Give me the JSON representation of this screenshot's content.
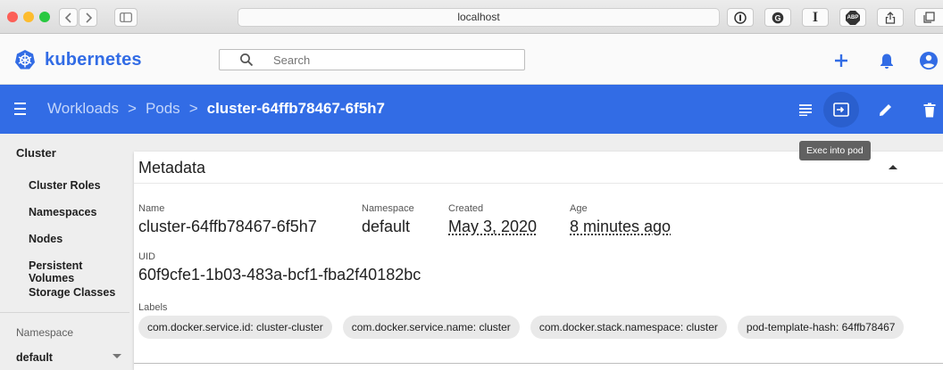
{
  "browser": {
    "url": "localhost",
    "extensions": [
      "onepassword-icon",
      "ghostery-icon",
      "instapaper-icon",
      "adblock-icon"
    ],
    "adblock_label": "ABP",
    "instapaper_label": "I"
  },
  "header": {
    "logo_text": "kubernetes",
    "search_placeholder": "Search",
    "accent_color": "#326ce5"
  },
  "toolbar": {
    "breadcrumb": {
      "workloads": "Workloads",
      "pods": "Pods",
      "separator": ">",
      "current": "cluster-64ffb78467-6f5h7"
    },
    "color": "#326ce5"
  },
  "tooltip": {
    "text": "Exec into pod"
  },
  "sidebar": {
    "section_title": "Cluster",
    "items": [
      {
        "label": "Cluster Roles"
      },
      {
        "label": "Namespaces"
      },
      {
        "label": "Nodes"
      },
      {
        "label": "Persistent Volumes"
      },
      {
        "label": "Storage Classes"
      }
    ],
    "namespace_label": "Namespace",
    "namespace_value": "default"
  },
  "metadata": {
    "title": "Metadata",
    "name_label": "Name",
    "name_value": "cluster-64ffb78467-6f5h7",
    "namespace_label": "Namespace",
    "namespace_value": "default",
    "created_label": "Created",
    "created_value": "May 3, 2020",
    "age_label": "Age",
    "age_value": "8 minutes ago",
    "uid_label": "UID",
    "uid_value": "60f9cfe1-1b03-483a-bcf1-fba2f40182bc",
    "labels_label": "Labels",
    "labels": [
      "com.docker.service.id: cluster-cluster",
      "com.docker.service.name: cluster",
      "com.docker.stack.namespace: cluster",
      "pod-template-hash: 64ffb78467"
    ]
  }
}
